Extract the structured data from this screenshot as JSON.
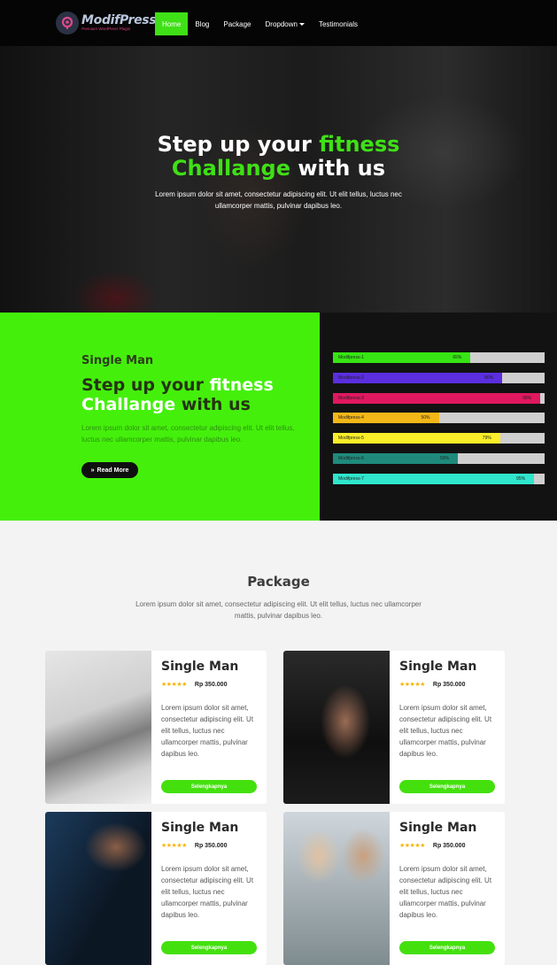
{
  "brand": {
    "name": "ModifPress",
    "tagline": "Premium WordPress Plugin"
  },
  "nav": {
    "items": [
      "Home",
      "Blog",
      "Package",
      "Dropdown",
      "Testimonials"
    ],
    "active": "Home"
  },
  "hero": {
    "title_part1": "Step up your ",
    "title_highlight1": "fitness",
    "title_highlight2": "Challange",
    "title_part2": " with us",
    "text": "Lorem ipsum dolor sit amet, consectetur adipiscing elit. Ut elit tellus, luctus nec ullamcorper mattis, pulvinar dapibus leo."
  },
  "promo": {
    "subtitle": "Single Man",
    "title_part1": "Step up your ",
    "title_highlight1": "fitness",
    "title_highlight2": "Challange",
    "title_part2": " with us",
    "text": "Lorem ipsum dolor sit amet, consectetur adipiscing elit. Ut elit tellus, luctus nec ullamcorper mattis, pulvinar dapibus leo.",
    "button": "Read More",
    "colors": {
      "background": "#44f00b",
      "panel": "#121212"
    }
  },
  "progress_bars": [
    {
      "label": "Modifpress-1",
      "value": 65,
      "pct_text": "65%",
      "color": "#36e513"
    },
    {
      "label": "Modifpress-2",
      "value": 80,
      "pct_text": "80%",
      "color": "#5b2ee0"
    },
    {
      "label": "Modifpress-3",
      "value": 98,
      "pct_text": "98%",
      "color": "#e0185f"
    },
    {
      "label": "Modifpress-4",
      "value": 50,
      "pct_text": "50%",
      "color": "#f3b718"
    },
    {
      "label": "Modifpress-5",
      "value": 79,
      "pct_text": "79%",
      "color": "#f9ee28"
    },
    {
      "label": "Modifpress-6",
      "value": 59,
      "pct_text": "59%",
      "color": "#1f8a7c"
    },
    {
      "label": "Modifpress-7",
      "value": 95,
      "pct_text": "95%",
      "color": "#2fe6cd"
    }
  ],
  "package": {
    "title": "Package",
    "text": "Lorem ipsum dolor sit amet, consectetur adipiscing elit. Ut elit tellus, luctus nec ullamcorper mattis, pulvinar dapibus leo.",
    "cards": [
      {
        "title": "Single Man",
        "rating": 5,
        "price": "Rp 350.000",
        "text": "Lorem ipsum dolor sit amet, consectetur adipiscing elit. Ut elit tellus, luctus nec ullamcorper mattis, pulvinar dapibus leo.",
        "button": "Selengkapnya"
      },
      {
        "title": "Single Man",
        "rating": 5,
        "price": "Rp 350.000",
        "text": "Lorem ipsum dolor sit amet, consectetur adipiscing elit. Ut elit tellus, luctus nec ullamcorper mattis, pulvinar dapibus leo.",
        "button": "Selengkapnya"
      },
      {
        "title": "Single Man",
        "rating": 5,
        "price": "Rp 350.000",
        "text": "Lorem ipsum dolor sit amet, consectetur adipiscing elit. Ut elit tellus, luctus nec ullamcorper mattis, pulvinar dapibus leo.",
        "button": "Selengkapnya"
      },
      {
        "title": "Single Man",
        "rating": 5,
        "price": "Rp 350.000",
        "text": "Lorem ipsum dolor sit amet, consectetur adipiscing elit. Ut elit tellus, luctus nec ullamcorper mattis, pulvinar dapibus leo.",
        "button": "Selengkapnya"
      }
    ]
  },
  "colors": {
    "accent": "#3fe016",
    "nav_bg": "#050505",
    "star": "#f4b400"
  }
}
